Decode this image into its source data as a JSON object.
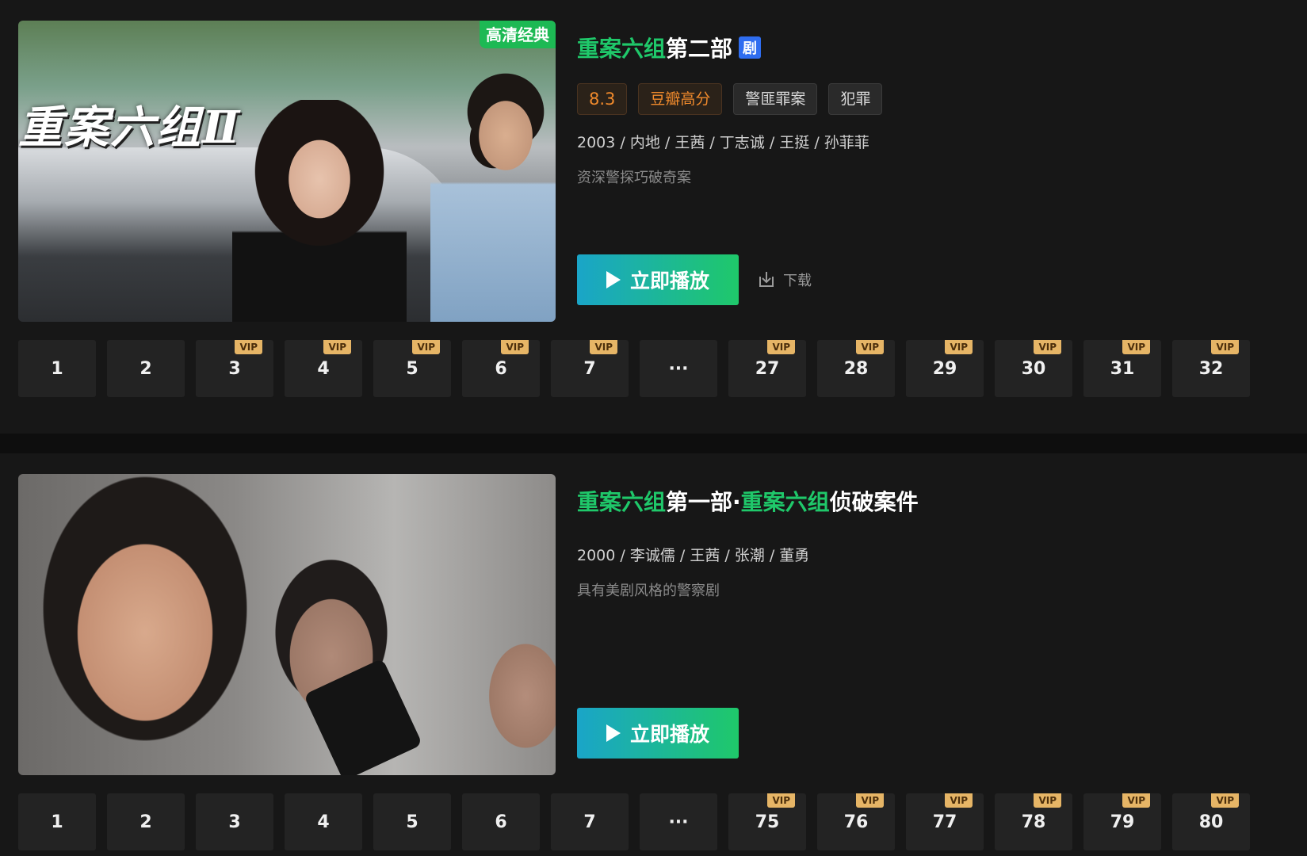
{
  "shows": [
    {
      "poster_badge": "高清经典",
      "poster_title": "重案六组Ⅱ",
      "title_highlight_1": "重案六组",
      "title_rest_1": "第二部",
      "drama_tag": "剧",
      "tags": {
        "score": "8.3",
        "douban": "豆瓣高分",
        "genre1": "警匪罪案",
        "genre2": "犯罪"
      },
      "meta": "2003 / 内地 / 王茜 / 丁志诚 / 王挺 / 孙菲菲",
      "desc": "资深警探巧破奇案",
      "play_label": "立即播放",
      "download_label": "下载",
      "episodes": [
        {
          "label": "1",
          "vip": ""
        },
        {
          "label": "2",
          "vip": ""
        },
        {
          "label": "3",
          "vip": "VIP"
        },
        {
          "label": "4",
          "vip": "VIP"
        },
        {
          "label": "5",
          "vip": "VIP"
        },
        {
          "label": "6",
          "vip": "VIP"
        },
        {
          "label": "7",
          "vip": "VIP"
        },
        {
          "label": "···",
          "vip": ""
        },
        {
          "label": "27",
          "vip": "VIP"
        },
        {
          "label": "28",
          "vip": "VIP"
        },
        {
          "label": "29",
          "vip": "VIP"
        },
        {
          "label": "30",
          "vip": "VIP"
        },
        {
          "label": "31",
          "vip": "VIP"
        },
        {
          "label": "32",
          "vip": "VIP"
        }
      ]
    },
    {
      "title_highlight_1": "重案六组",
      "title_rest_1": "第一部·",
      "title_highlight_2": "重案六组",
      "title_rest_2": "侦破案件",
      "meta": "2000 / 李诚儒 / 王茜 / 张潮 / 董勇",
      "desc": "具有美剧风格的警察剧",
      "play_label": "立即播放",
      "episodes": [
        {
          "label": "1",
          "vip": ""
        },
        {
          "label": "2",
          "vip": ""
        },
        {
          "label": "3",
          "vip": ""
        },
        {
          "label": "4",
          "vip": ""
        },
        {
          "label": "5",
          "vip": ""
        },
        {
          "label": "6",
          "vip": ""
        },
        {
          "label": "7",
          "vip": ""
        },
        {
          "label": "···",
          "vip": ""
        },
        {
          "label": "75",
          "vip": "VIP"
        },
        {
          "label": "76",
          "vip": "VIP"
        },
        {
          "label": "77",
          "vip": "VIP"
        },
        {
          "label": "78",
          "vip": "VIP"
        },
        {
          "label": "79",
          "vip": "VIP"
        },
        {
          "label": "80",
          "vip": "VIP"
        }
      ]
    }
  ],
  "colors": {
    "accent_green": "#1fc86a",
    "play_gradient_start": "#1aa5c8",
    "vip_gold": "#e6b566",
    "drama_blue": "#2f6df0"
  }
}
